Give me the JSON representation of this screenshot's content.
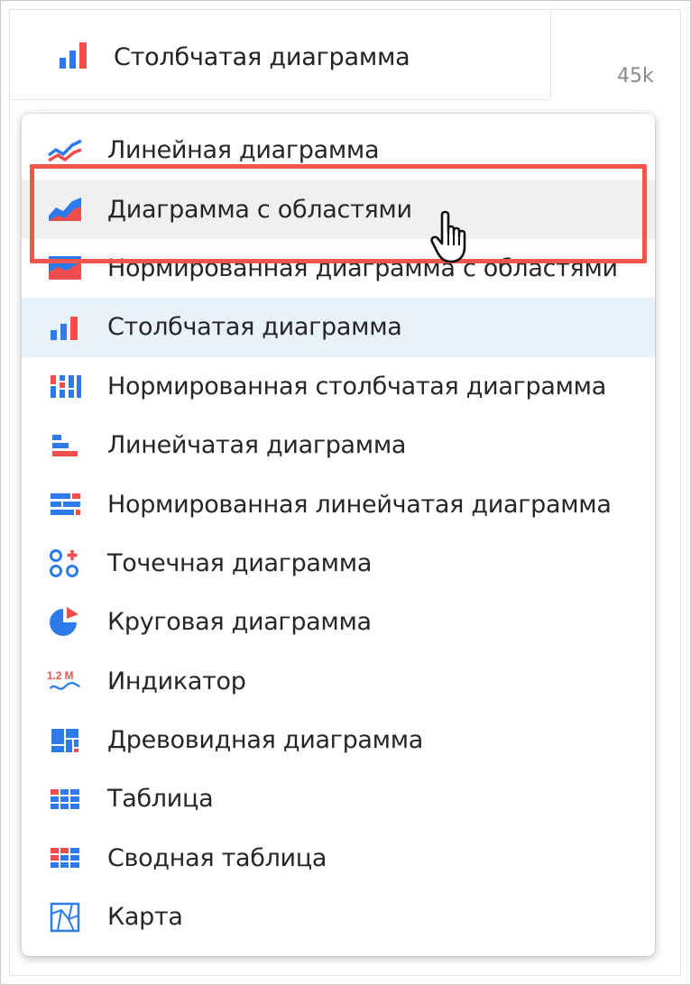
{
  "header": {
    "label": "Столбчатая диаграмма",
    "icon": "bar-chart-icon"
  },
  "axis": {
    "tick_label": "45k"
  },
  "menu": {
    "items": [
      {
        "label": "Линейная диаграмма",
        "icon": "line-chart-icon",
        "state": ""
      },
      {
        "label": "Диаграмма с областями",
        "icon": "area-chart-icon",
        "state": "hover"
      },
      {
        "label": "Нормированная диаграмма с областями",
        "icon": "normalized-area-chart-icon",
        "state": ""
      },
      {
        "label": "Столбчатая диаграмма",
        "icon": "bar-chart-icon",
        "state": "selected"
      },
      {
        "label": "Нормированная столбчатая диаграмма",
        "icon": "normalized-bar-chart-icon",
        "state": ""
      },
      {
        "label": "Линейчатая диаграмма",
        "icon": "horizontal-bar-chart-icon",
        "state": ""
      },
      {
        "label": "Нормированная линейчатая диаграмма",
        "icon": "normalized-horizontal-bar-chart-icon",
        "state": ""
      },
      {
        "label": "Точечная диаграмма",
        "icon": "scatter-chart-icon",
        "state": ""
      },
      {
        "label": "Круговая диаграмма",
        "icon": "pie-chart-icon",
        "state": ""
      },
      {
        "label": "Индикатор",
        "icon": "indicator-icon",
        "state": "",
        "icon_text": "1.2 M"
      },
      {
        "label": "Древовидная диаграмма",
        "icon": "treemap-icon",
        "state": ""
      },
      {
        "label": "Таблица",
        "icon": "table-icon",
        "state": ""
      },
      {
        "label": "Сводная таблица",
        "icon": "pivot-table-icon",
        "state": ""
      },
      {
        "label": "Карта",
        "icon": "map-icon",
        "state": ""
      }
    ]
  },
  "colors": {
    "blue": "#2d7bea",
    "red": "#f24d4d",
    "highlight": "#f0564c",
    "selected_bg": "#e9f1fb",
    "hover_bg": "#f0f0f0"
  }
}
